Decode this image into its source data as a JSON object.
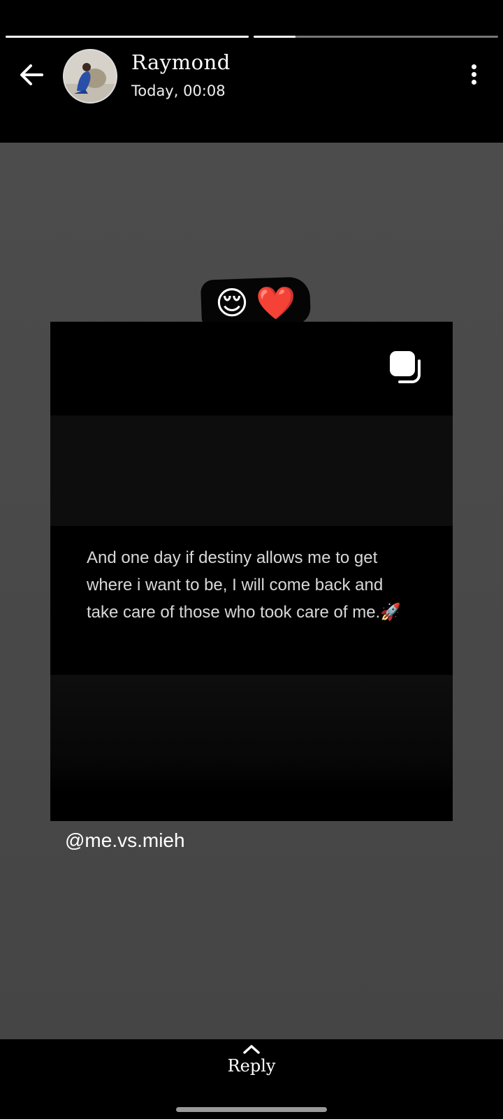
{
  "story": {
    "author_name": "Raymond",
    "timestamp": "Today, 00:08",
    "progress": [
      {
        "segment": 1,
        "fraction": 1.0
      },
      {
        "segment": 2,
        "fraction": 0.17
      }
    ]
  },
  "sticker": {
    "emojis": [
      "😌",
      "❤️"
    ]
  },
  "post": {
    "quote": "And one day if destiny allows me to get where i want to be, I will come back and take care of those who took care of me.🚀",
    "handle": "@me.vs.mieh"
  },
  "footer": {
    "reply_label": "Reply"
  },
  "icons": {
    "back": "back-arrow-icon",
    "menu": "more-options-icon",
    "copy": "multiple-images-icon",
    "reply": "chevron-up-icon"
  }
}
